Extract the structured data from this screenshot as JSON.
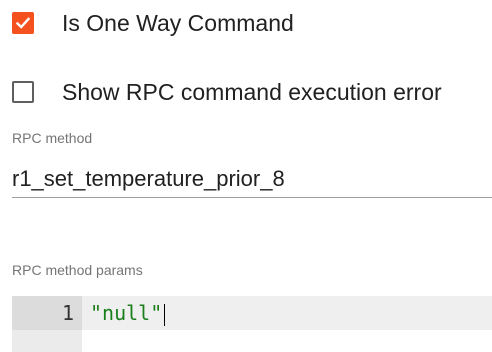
{
  "checkboxes": [
    {
      "label": "Is One Way Command",
      "checked": true
    },
    {
      "label": "Show RPC command execution error",
      "checked": false
    }
  ],
  "rpc_method": {
    "label": "RPC method",
    "value": "r1_set_temperature_prior_8"
  },
  "rpc_params": {
    "label": "RPC method params",
    "line_number": "1",
    "code": "\"null\""
  },
  "colors": {
    "accent": "#f4511e",
    "code_string": "#1a7f1a",
    "label_gray": "#757575"
  },
  "icons": {
    "checked": "checkmark-icon"
  }
}
